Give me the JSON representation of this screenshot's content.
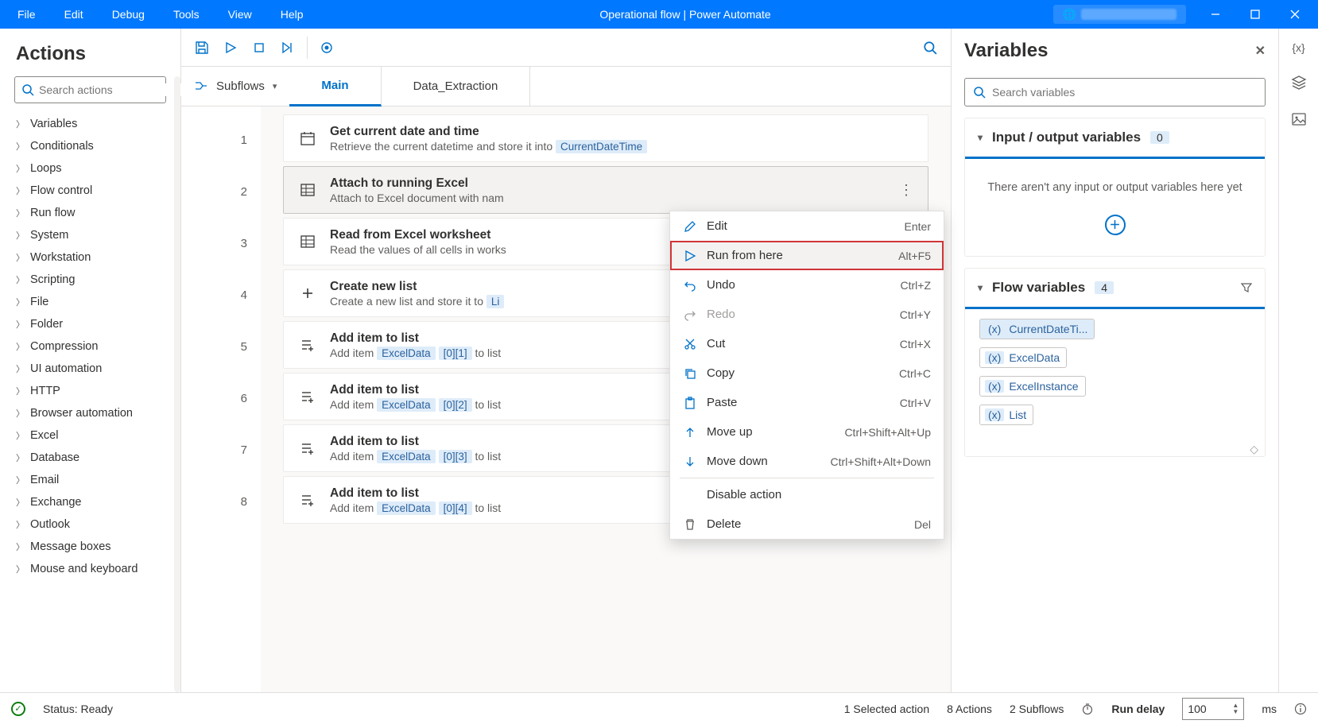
{
  "menu": {
    "items": [
      "File",
      "Edit",
      "Debug",
      "Tools",
      "View",
      "Help"
    ]
  },
  "app_title": "Operational flow | Power Automate",
  "actions": {
    "title": "Actions",
    "search_placeholder": "Search actions",
    "tree": [
      "Variables",
      "Conditionals",
      "Loops",
      "Flow control",
      "Run flow",
      "System",
      "Workstation",
      "Scripting",
      "File",
      "Folder",
      "Compression",
      "UI automation",
      "HTTP",
      "Browser automation",
      "Excel",
      "Database",
      "Email",
      "Exchange",
      "Outlook",
      "Message boxes",
      "Mouse and keyboard"
    ]
  },
  "toolbar": {
    "icons": [
      "save",
      "run",
      "stop",
      "step",
      "record",
      "search"
    ]
  },
  "tabs": {
    "subflows_label": "Subflows",
    "items": [
      "Main",
      "Data_Extraction"
    ],
    "active": "Main"
  },
  "flow_actions": [
    {
      "n": "1",
      "icon": "calendar",
      "title": "Get current date and time",
      "desc_pre": "Retrieve the current datetime and store it into",
      "token": "CurrentDateTime",
      "desc_post": ""
    },
    {
      "n": "2",
      "icon": "excel",
      "title": "Attach to running Excel",
      "desc_pre": "Attach to Excel document with nam",
      "selected": true
    },
    {
      "n": "3",
      "icon": "excel",
      "title": "Read from Excel worksheet",
      "desc_pre": "Read the values of all cells in works"
    },
    {
      "n": "4",
      "icon": "plus",
      "title": "Create new list",
      "desc_pre": "Create a new list and store it to",
      "token": "Li"
    },
    {
      "n": "5",
      "icon": "listadd",
      "title": "Add item to list",
      "desc_pre": "Add item",
      "token": "ExcelData",
      "extra": "[0][1]",
      "desc_post": "to list"
    },
    {
      "n": "6",
      "icon": "listadd",
      "title": "Add item to list",
      "desc_pre": "Add item",
      "token": "ExcelData",
      "extra": "[0][2]",
      "desc_post": "to list"
    },
    {
      "n": "7",
      "icon": "listadd",
      "title": "Add item to list",
      "desc_pre": "Add item",
      "token": "ExcelData",
      "extra": "[0][3]",
      "desc_post": "to list"
    },
    {
      "n": "8",
      "icon": "listadd",
      "title": "Add item to list",
      "desc_pre": "Add item",
      "token": "ExcelData",
      "extra": "[0][4]",
      "desc_post": "to list"
    }
  ],
  "context_menu": {
    "items": [
      {
        "icon": "edit",
        "label": "Edit",
        "shortcut": "Enter"
      },
      {
        "icon": "run",
        "label": "Run from here",
        "shortcut": "Alt+F5",
        "highlight": true
      },
      {
        "icon": "undo",
        "label": "Undo",
        "shortcut": "Ctrl+Z"
      },
      {
        "icon": "redo",
        "label": "Redo",
        "shortcut": "Ctrl+Y",
        "disabled": true
      },
      {
        "icon": "cut",
        "label": "Cut",
        "shortcut": "Ctrl+X"
      },
      {
        "icon": "copy",
        "label": "Copy",
        "shortcut": "Ctrl+C"
      },
      {
        "icon": "paste",
        "label": "Paste",
        "shortcut": "Ctrl+V"
      },
      {
        "icon": "up",
        "label": "Move up",
        "shortcut": "Ctrl+Shift+Alt+Up"
      },
      {
        "icon": "down",
        "label": "Move down",
        "shortcut": "Ctrl+Shift+Alt+Down"
      },
      {
        "divider": true
      },
      {
        "indent": true,
        "label": "Disable action",
        "shortcut": ""
      },
      {
        "icon": "delete",
        "label": "Delete",
        "shortcut": "Del"
      }
    ]
  },
  "variables": {
    "title": "Variables",
    "search_placeholder": "Search variables",
    "io": {
      "title": "Input / output variables",
      "count": "0",
      "empty": "There aren't any input or output variables here yet"
    },
    "flow": {
      "title": "Flow variables",
      "count": "4",
      "items": [
        "CurrentDateTi...",
        "ExcelData",
        "ExcelInstance",
        "List"
      ]
    }
  },
  "status": {
    "ready": "Status: Ready",
    "selected": "1 Selected action",
    "actions": "8 Actions",
    "subflows": "2 Subflows",
    "run_delay": "Run delay",
    "delay_value": "100",
    "delay_unit": "ms"
  }
}
